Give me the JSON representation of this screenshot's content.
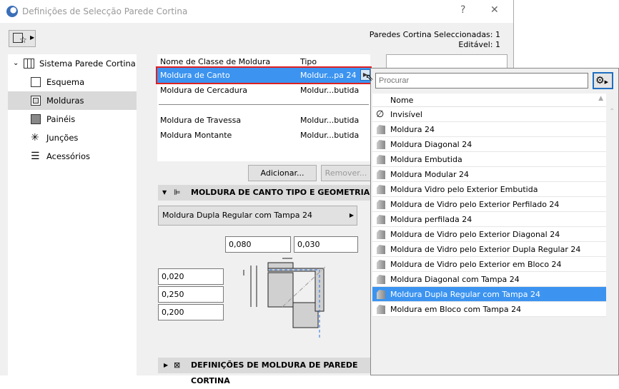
{
  "window": {
    "title": "Definições de Selecção Parede Cortina",
    "help": "?",
    "close": "✕"
  },
  "selection": {
    "selected": "Paredes Cortina Seleccionadas: 1",
    "editable": "Editável: 1"
  },
  "sidebar": {
    "root": "Sistema Parede Cortina",
    "items": [
      {
        "label": "Esquema"
      },
      {
        "label": "Molduras"
      },
      {
        "label": "Painéis"
      },
      {
        "label": "Junções"
      },
      {
        "label": "Acessórios"
      }
    ]
  },
  "frames": {
    "headers": {
      "name": "Nome de Classe de Moldura",
      "type": "Tipo"
    },
    "rows": [
      {
        "name": "Moldura de Canto",
        "type": "Moldur...pa 24"
      },
      {
        "name": "Moldura de Cercadura",
        "type": "Moldur...butida"
      },
      {
        "name": "Moldura de Travessa",
        "type": "Moldur...butida"
      },
      {
        "name": "Moldura Montante",
        "type": "Moldur...butida"
      }
    ],
    "add": "Adicionar...",
    "remove": "Remover..."
  },
  "geometry": {
    "header": "MOLDURA DE CANTO TIPO E GEOMETRIA",
    "type": "Moldura Dupla Regular com Tampa 24",
    "top1": "0,080",
    "top2": "0,030",
    "left1": "0,020",
    "left2": "0,250",
    "left3": "0,200"
  },
  "settings": {
    "header": "DEFINIÇÕES DE MOLDURA DE PAREDE CORTINA"
  },
  "popup": {
    "search_placeholder": "Procurar",
    "column": "Nome",
    "selected_index": 12,
    "items": [
      "Invisível",
      "Moldura 24",
      "Moldura Diagonal 24",
      "Moldura Embutida",
      "Moldura Modular 24",
      "Moldura Vidro pelo Exterior Embutida",
      "Moldura de Vidro pelo Exterior Perfilado 24",
      "Moldura perfilada 24",
      "Moldura de Vidro pelo Exterior Diagonal 24",
      "Moldura de Vidro pelo Exterior Dupla Regular 24",
      "Moldura de Vidro pelo Exterior em Bloco 24",
      "Moldura Diagonal com Tampa 24",
      "Moldura Dupla Regular com Tampa 24",
      "Moldura em Bloco com Tampa 24"
    ]
  }
}
